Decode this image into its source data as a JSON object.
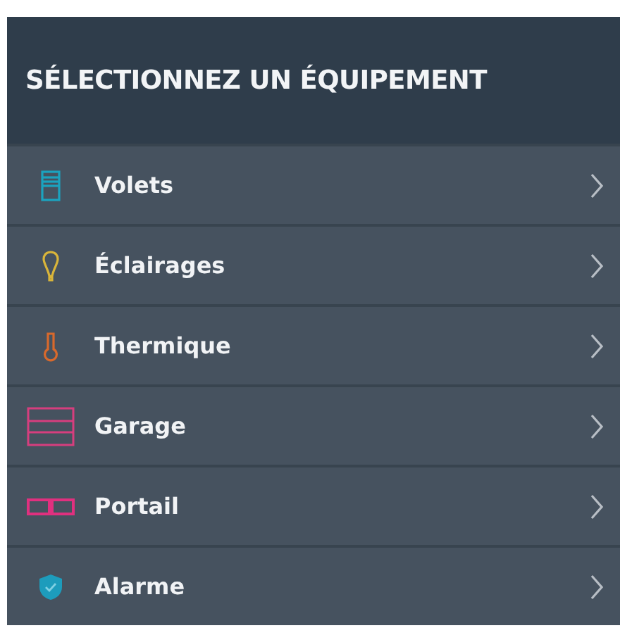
{
  "header": {
    "title": "SÉLECTIONNEZ UN ÉQUIPEMENT"
  },
  "items": [
    {
      "label": "Volets",
      "kind": "shutter",
      "color": "#1ba3bf"
    },
    {
      "label": "Éclairages",
      "kind": "bulb",
      "color": "#d9b53a"
    },
    {
      "label": "Thermique",
      "kind": "thermometer",
      "color": "#d8692c"
    },
    {
      "label": "Garage",
      "kind": "garage",
      "color": "#d63e7e"
    },
    {
      "label": "Portail",
      "kind": "gate",
      "color": "#e0307f"
    },
    {
      "label": "Alarme",
      "kind": "shield",
      "color": "#1d9cbc"
    }
  ]
}
